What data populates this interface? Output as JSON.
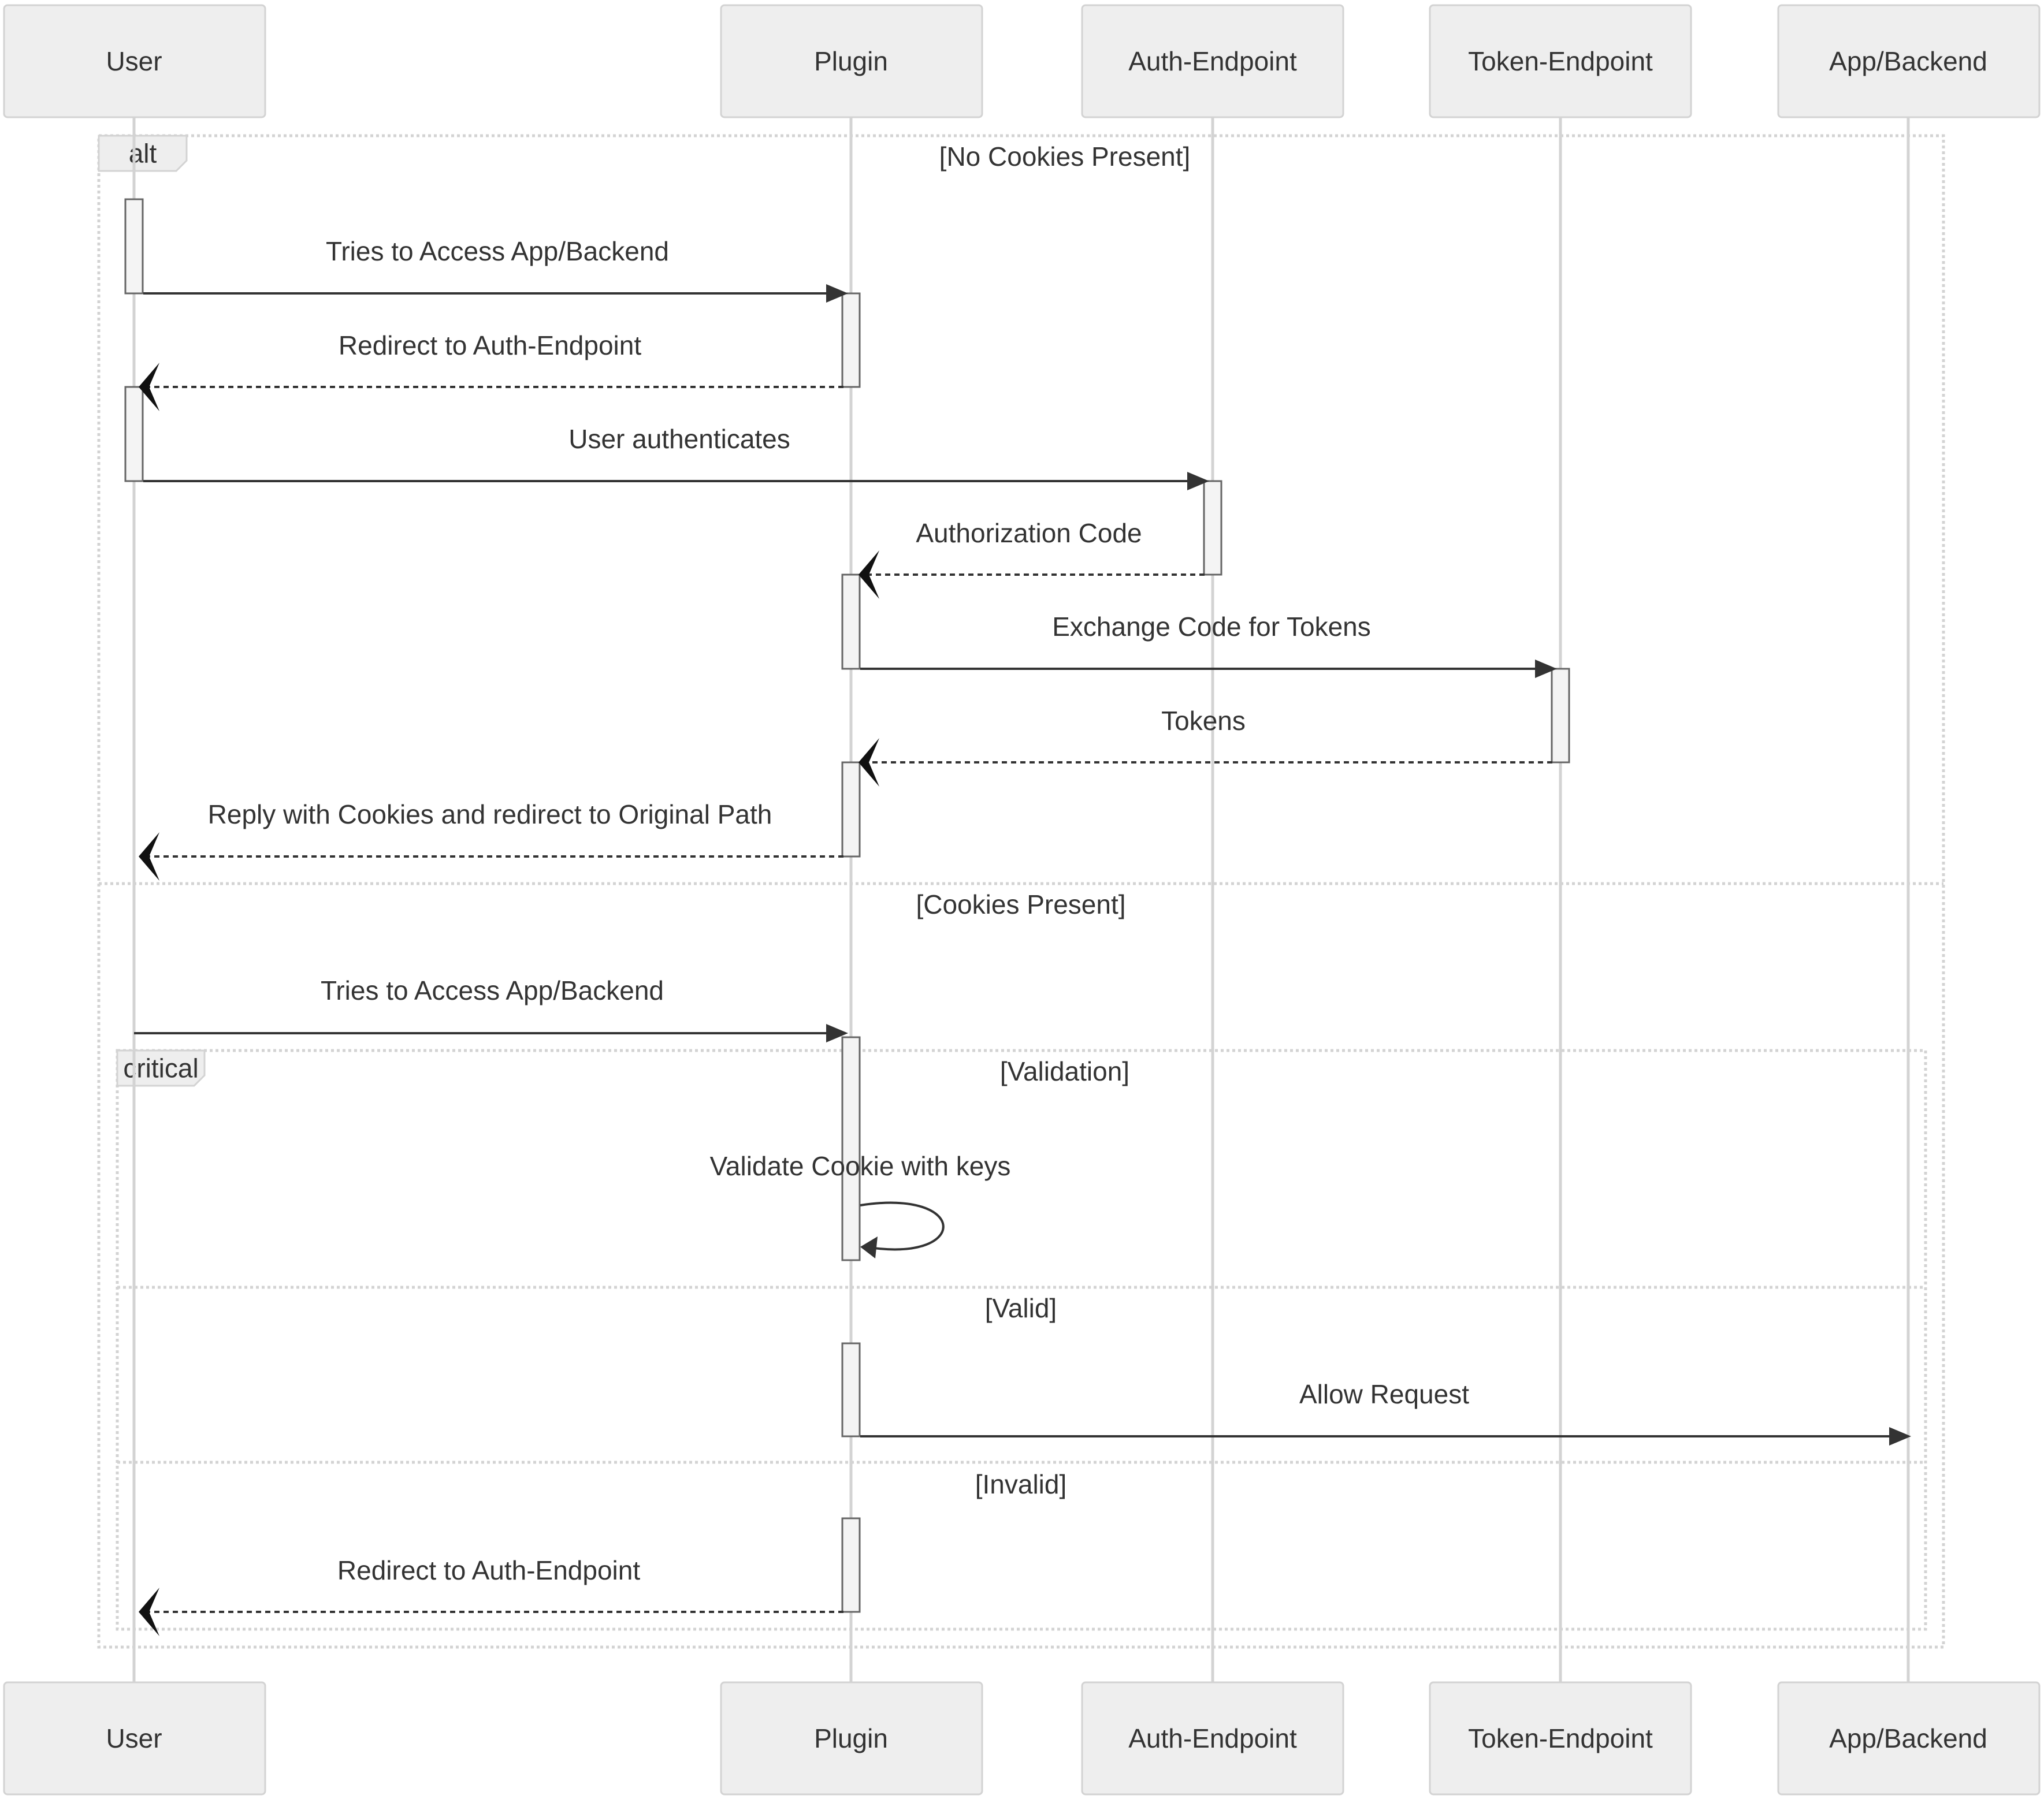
{
  "diagram": {
    "type": "sequence",
    "participants": [
      {
        "id": "user",
        "label": "User"
      },
      {
        "id": "plugin",
        "label": "Plugin"
      },
      {
        "id": "auth",
        "label": "Auth-Endpoint"
      },
      {
        "id": "token",
        "label": "Token-Endpoint"
      },
      {
        "id": "app",
        "label": "App/Backend"
      }
    ],
    "frames": [
      {
        "kind": "alt",
        "label": "alt",
        "sections": [
          {
            "condition": "[No Cookies Present]"
          },
          {
            "condition": "[Cookies Present]"
          }
        ]
      },
      {
        "kind": "critical",
        "label": "critical",
        "sections": [
          {
            "condition": "[Validation]"
          },
          {
            "condition": "[Valid]"
          },
          {
            "condition": "[Invalid]"
          }
        ]
      }
    ],
    "messages": [
      {
        "from": "user",
        "to": "plugin",
        "text": "Tries to Access App/Backend",
        "style": "solid"
      },
      {
        "from": "plugin",
        "to": "user",
        "text": "Redirect to Auth-Endpoint",
        "style": "dashed"
      },
      {
        "from": "user",
        "to": "auth",
        "text": "User authenticates",
        "style": "solid"
      },
      {
        "from": "auth",
        "to": "plugin",
        "text": "Authorization Code",
        "style": "dashed"
      },
      {
        "from": "plugin",
        "to": "token",
        "text": "Exchange Code for Tokens",
        "style": "solid"
      },
      {
        "from": "token",
        "to": "plugin",
        "text": "Tokens",
        "style": "dashed"
      },
      {
        "from": "plugin",
        "to": "user",
        "text": "Reply with Cookies and redirect to Original Path",
        "style": "dashed"
      },
      {
        "from": "user",
        "to": "plugin",
        "text": "Tries to Access App/Backend",
        "style": "solid"
      },
      {
        "from": "plugin",
        "to": "plugin",
        "text": "Validate Cookie with keys",
        "style": "solid"
      },
      {
        "from": "plugin",
        "to": "app",
        "text": "Allow Request",
        "style": "solid"
      },
      {
        "from": "plugin",
        "to": "user",
        "text": "Redirect to Auth-Endpoint",
        "style": "dashed"
      }
    ]
  }
}
